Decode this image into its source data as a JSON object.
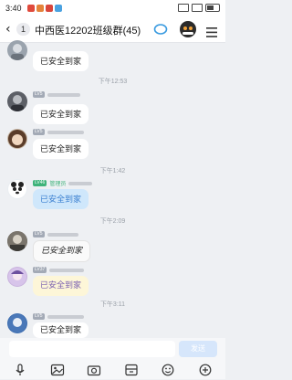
{
  "status": {
    "time": "3:40"
  },
  "header": {
    "back_badge": "1",
    "title": "中西医12202班级群(45)"
  },
  "messages": [
    {
      "text": "已安全到家",
      "style": "plain"
    },
    {
      "timestamp": "下午12:53",
      "level": "LV5",
      "text": "已安全到家",
      "style": "plain"
    },
    {
      "level": "LV5",
      "text": "已安全到家",
      "style": "plain"
    },
    {
      "timestamp": "下午1:42",
      "level": "LV46",
      "sender_tag": "管理员",
      "text": "已安全到家",
      "style": "blue"
    },
    {
      "timestamp": "下午2:09",
      "level": "LV5",
      "text": "已安全到家",
      "style": "handwritten"
    },
    {
      "level": "LV37",
      "text": "已安全到家",
      "style": "yellow"
    },
    {
      "timestamp": "下午3:11",
      "level": "LV5",
      "text": "已安全到家",
      "style": "plain"
    }
  ],
  "input": {
    "send_label": "发送"
  },
  "icons": {
    "header": [
      "back-arrow-icon",
      "circle-icon",
      "cat-avatar-icon",
      "menu-icon"
    ],
    "toolbar": [
      "mic-icon",
      "image-icon",
      "camera-icon",
      "file-icon",
      "emoji-icon",
      "plus-icon"
    ]
  },
  "colors": {
    "accent": "#3a7fd0",
    "bubble_blue": "#cfe7fb",
    "background": "#eef0f3"
  }
}
